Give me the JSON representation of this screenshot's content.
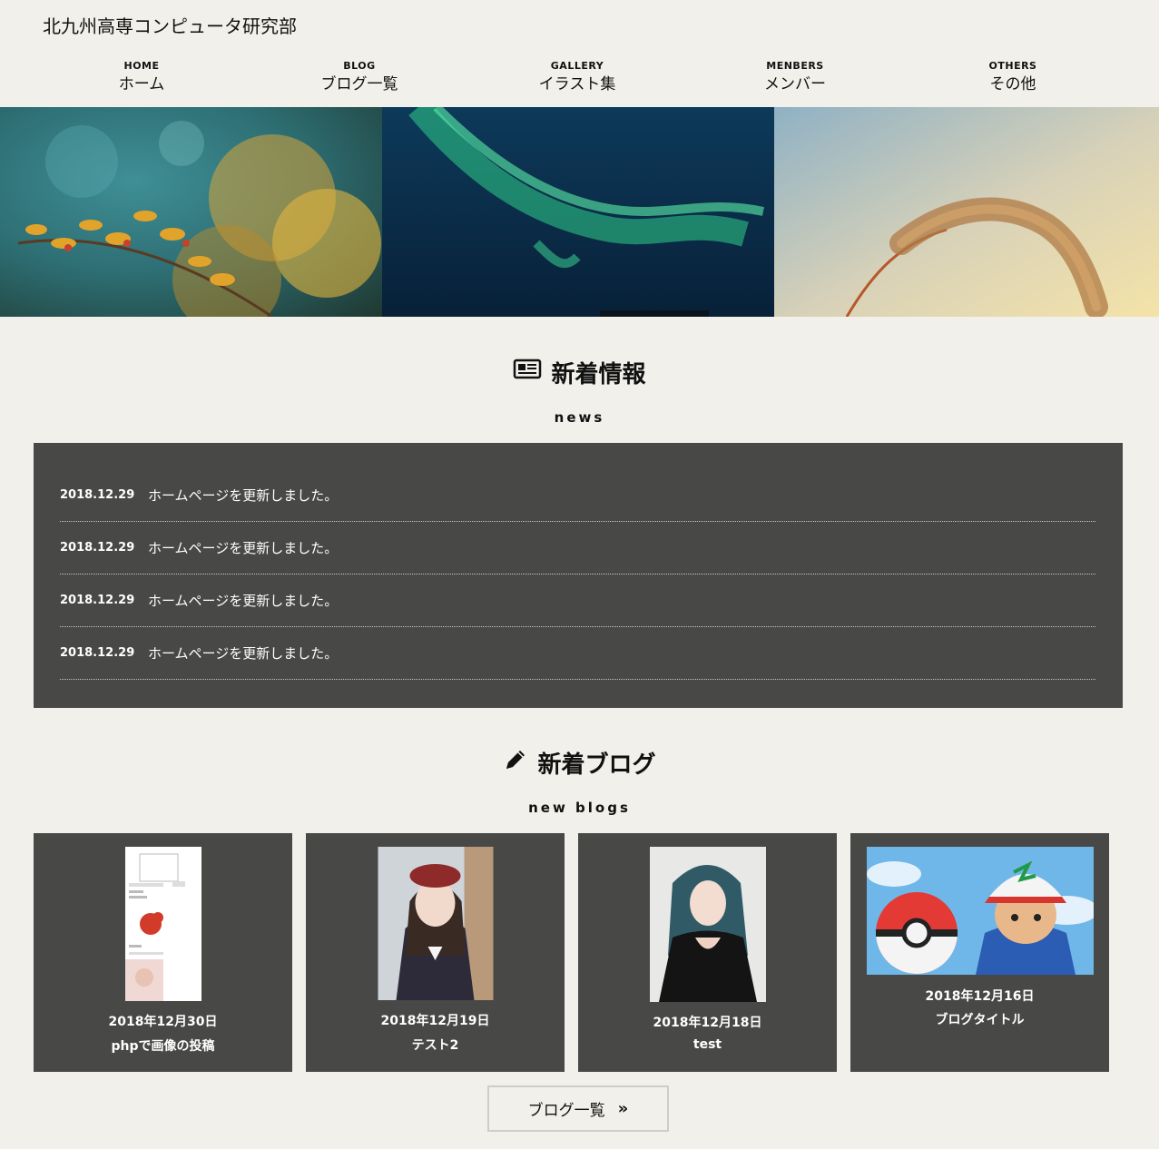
{
  "site": {
    "title": "北九州高専コンピュータ研究部"
  },
  "nav": [
    {
      "en": "HOME",
      "ja": "ホーム"
    },
    {
      "en": "BLOG",
      "ja": "ブログ一覧"
    },
    {
      "en": "GALLERY",
      "ja": "イラスト集"
    },
    {
      "en": "MENBERS",
      "ja": "メンバー"
    },
    {
      "en": "OTHERS",
      "ja": "その他"
    }
  ],
  "news": {
    "heading": "新着情報",
    "sub": "news",
    "items": [
      {
        "date": "2018.12.29",
        "text": "ホームページを更新しました。"
      },
      {
        "date": "2018.12.29",
        "text": "ホームページを更新しました。"
      },
      {
        "date": "2018.12.29",
        "text": "ホームページを更新しました。"
      },
      {
        "date": "2018.12.29",
        "text": "ホームページを更新しました。"
      }
    ]
  },
  "blogs": {
    "heading": "新着ブログ",
    "sub": "new blogs",
    "items": [
      {
        "date": "2018年12月30日",
        "title": "phpで画像の投稿"
      },
      {
        "date": "2018年12月19日",
        "title": "テスト2"
      },
      {
        "date": "2018年12月18日",
        "title": "test"
      },
      {
        "date": "2018年12月16日",
        "title": "ブログタイトル"
      }
    ],
    "more_label": "ブログ一覧",
    "more_icon": "double-chevron-right-icon"
  },
  "colors": {
    "background": "#f2f0ea",
    "panel": "#484846",
    "text": "#111111"
  }
}
